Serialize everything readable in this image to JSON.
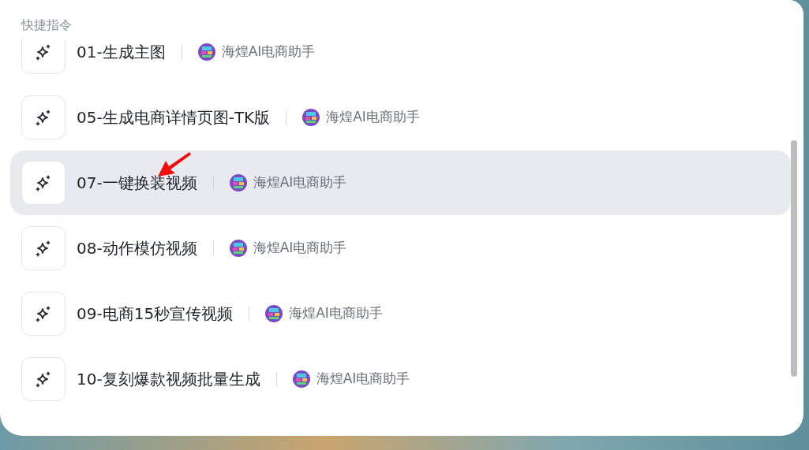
{
  "panel": {
    "title": "快捷指令"
  },
  "items": [
    {
      "title": "01-生成主图",
      "author": "海煌AI电商助手",
      "selected": false
    },
    {
      "title": "05-生成电商详情页图-TK版",
      "author": "海煌AI电商助手",
      "selected": false
    },
    {
      "title": "07-一键换装视频",
      "author": "海煌AI电商助手",
      "selected": true
    },
    {
      "title": "08-动作模仿视频",
      "author": "海煌AI电商助手",
      "selected": false
    },
    {
      "title": "09-电商15秒宣传视频",
      "author": "海煌AI电商助手",
      "selected": false
    },
    {
      "title": "10-复刻爆款视频批量生成",
      "author": "海煌AI电商助手",
      "selected": false
    }
  ]
}
